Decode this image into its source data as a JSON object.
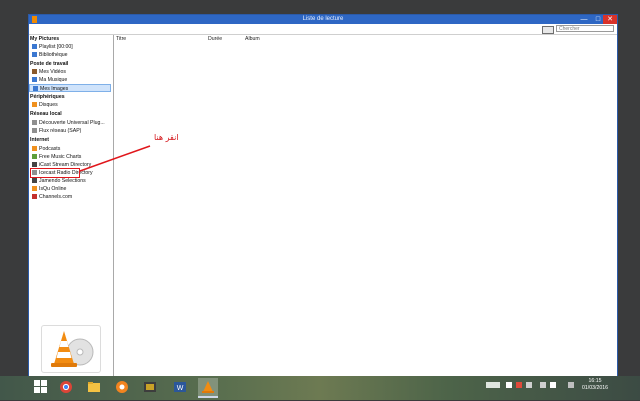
{
  "window": {
    "title": "Liste de lecture",
    "min_glyph": "—",
    "max_glyph": "□",
    "close_glyph": "✕"
  },
  "toolbar": {
    "search_placeholder": "Chercher"
  },
  "sidebar": {
    "sections": [
      {
        "label": "My Pictures",
        "items": [
          {
            "label": "Playlist [00:00]",
            "icon": "playlist-icon"
          },
          {
            "label": "Bibliothèque",
            "icon": "library-icon"
          }
        ]
      },
      {
        "label": "Poste de travail",
        "items": [
          {
            "label": "Mes Vidéos",
            "icon": "film-icon"
          },
          {
            "label": "Ma Musique",
            "icon": "music-icon"
          },
          {
            "label": "Mes Images",
            "icon": "image-icon",
            "selected": true
          }
        ]
      },
      {
        "label": "Périphériques",
        "items": [
          {
            "label": "Disques",
            "icon": "disc-icon"
          }
        ]
      },
      {
        "label": "Réseau local",
        "items": [
          {
            "label": "Découverte Universal Plug...",
            "icon": "network-icon"
          },
          {
            "label": "Flux réseau (SAP)",
            "icon": "network-icon"
          }
        ]
      },
      {
        "label": "Internet",
        "items": [
          {
            "label": "Podcasts",
            "icon": "podcast-icon"
          },
          {
            "label": "Free Music Charts",
            "icon": "music-chart-icon"
          },
          {
            "label": "iCast Stream Directory",
            "icon": "stream-icon"
          },
          {
            "label": "Icecast Radio Directory",
            "icon": "radio-icon"
          },
          {
            "label": "Jamendo Selections",
            "icon": "jamendo-icon"
          },
          {
            "label": "IsQu Online",
            "icon": "lsqu-icon"
          },
          {
            "label": "Channels.com",
            "icon": "channels-icon"
          }
        ]
      }
    ]
  },
  "playlist": {
    "columns": [
      "Titre",
      "Durée",
      "Album"
    ]
  },
  "annotation": {
    "text": "انقر هنا",
    "color": "#e0161b"
  },
  "taskbar": {
    "time": "16:15",
    "date": "01/03/2016"
  },
  "colors": {
    "accent": "#2e67c4",
    "selection": "#cfe3fb",
    "close": "#d9322a"
  }
}
